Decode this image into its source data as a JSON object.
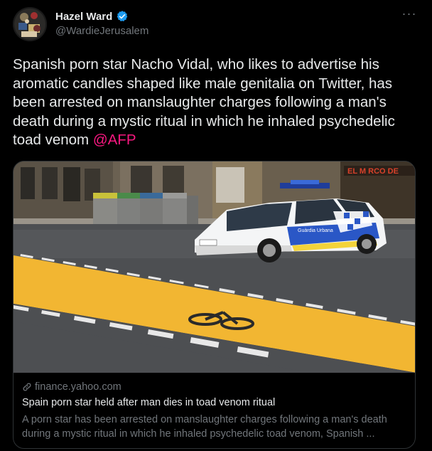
{
  "author": {
    "name": "Hazel Ward",
    "handle": "@WardieJerusalem",
    "verified_icon": "verified-badge-icon"
  },
  "more_label": "···",
  "tweet": {
    "text_main": "Spanish porn star Nacho Vidal, who likes to advertise his aromatic candles shaped like male genitalia on Twitter, has been arrested on manslaughter charges following a man's death during a mystic ritual in which he inhaled psychedelic toad venom ",
    "mention": "@AFP"
  },
  "card": {
    "image_alt": "Guardia Urbana police car on a street with a yellow bike lane",
    "car_text": "Guàrdia Urbana",
    "shop_sign": "EL M  RCO DE",
    "domain": "finance.yahoo.com",
    "title": "Spain porn star held after man dies in toad venom ritual",
    "description": "A porn star has been arrested on manslaughter charges following a man's death during a mystic ritual in which he inhaled psychedelic toad venom, Spanish ..."
  },
  "colors": {
    "background": "#000000",
    "text": "#e7e9ea",
    "secondary": "#71767b",
    "mention": "#f91880",
    "verified": "#1d9bf0",
    "bike_lane": "#f2b632"
  }
}
